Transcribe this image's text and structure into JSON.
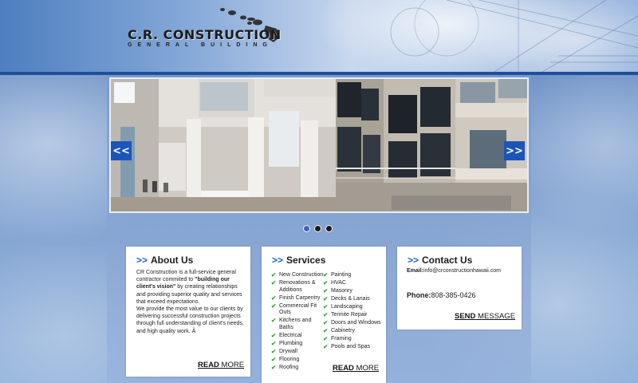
{
  "brand": {
    "title": "C.R. CONSTRUCTION",
    "subtitle": "GENERAL BUILDING"
  },
  "slider": {
    "prev_label": "<<",
    "next_label": ">>",
    "dot_count": 3,
    "active_index": 0
  },
  "about": {
    "chevron": ">>",
    "title": "About Us",
    "p1_before": "CR Construction is a full-service general contractor commited to ",
    "p1_bold": "\"building our client's vision\"",
    "p1_after": " by creating relationships and providing superior quality and services that exceed expectations.",
    "p2": "We provide the most value to our clients by delivering successful construction projects through full understanding of client's needs, and high quality work. Â",
    "more_bold": "READ",
    "more_rest": " MORE"
  },
  "services": {
    "chevron": ">>",
    "title": "Services",
    "col1": [
      "New Construction",
      "Renovations & Additions",
      "Finish Carpentry",
      "Commercial Fit Outs",
      "Kitchens and Baths",
      "Electrical",
      "Plumbing",
      "Drywall",
      "Flooring",
      "Roofing"
    ],
    "col2": [
      "Painting",
      "HVAC",
      "Masonry",
      "Decks & Lanais",
      "Landscaping",
      "Termite Repair",
      "Doors and Windows",
      "Cabinetry",
      "Framing",
      "Pools and Spas"
    ],
    "check_glyph": "✔",
    "more_bold": "READ",
    "more_rest": " MORE"
  },
  "contact": {
    "chevron": ">>",
    "title": "Contact Us",
    "email_label": "Email:",
    "email_value": "info@crconstructionhawaii.com",
    "phone_label": "Phone:",
    "phone_value": "808-385-0426",
    "more_bold": "SEND",
    "more_rest": " MESSAGE"
  },
  "colors": {
    "accent_blue": "#1b55b8",
    "check_green": "#3ea13e",
    "header_bar": "#1f4f9a"
  }
}
